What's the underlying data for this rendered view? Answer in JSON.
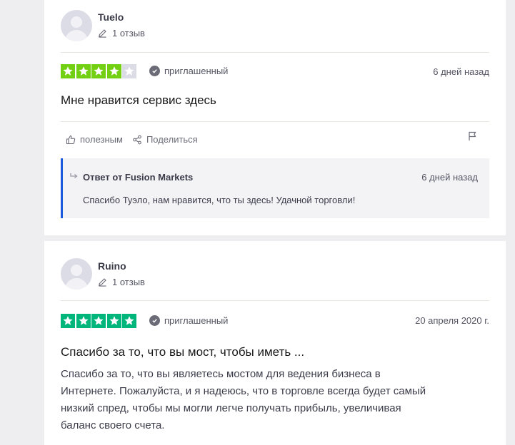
{
  "reviews": [
    {
      "user_name": "Tuelo",
      "review_count": "1 отзыв",
      "rating": 4,
      "max_rating": 5,
      "star_color": "#73cf11",
      "invited_label": "приглашенный",
      "date": "6 дней назад",
      "title": "Мне нравится сервис здесь",
      "actions": {
        "useful": "полезным",
        "share": "Поделиться"
      },
      "reply": {
        "heading": "Ответ от Fusion Markets",
        "date": "6 дней назад",
        "text": "Спасибо Туэло, нам нравится, что ты здесь! Удачной торговли!"
      }
    },
    {
      "user_name": "Ruino",
      "review_count": "1 отзыв",
      "rating": 5,
      "max_rating": 5,
      "star_color": "#00b67a",
      "invited_label": "приглашенный",
      "date": "20 апреля 2020 г.",
      "title": "Спасибо за то, что вы мост, чтобы иметь ...",
      "text_lines": [
        "Спасибо за то, что вы являетесь мостом для ведения бизнеса в",
        "Интернете. Пожалуйста, и я надеюсь, что в торговле всегда будет самый",
        "низкий спред, чтобы мы могли легче получать прибыль, увеличивая",
        "баланс своего счета."
      ]
    }
  ],
  "icons": [
    "avatar-placeholder",
    "pencil-icon",
    "star-icon",
    "check-icon",
    "thumbs-up-icon",
    "share-icon",
    "flag-icon",
    "reply-arrow-icon"
  ],
  "colors": {
    "reply_border": "#1b5adc",
    "empty_star": "#dcdce6"
  }
}
